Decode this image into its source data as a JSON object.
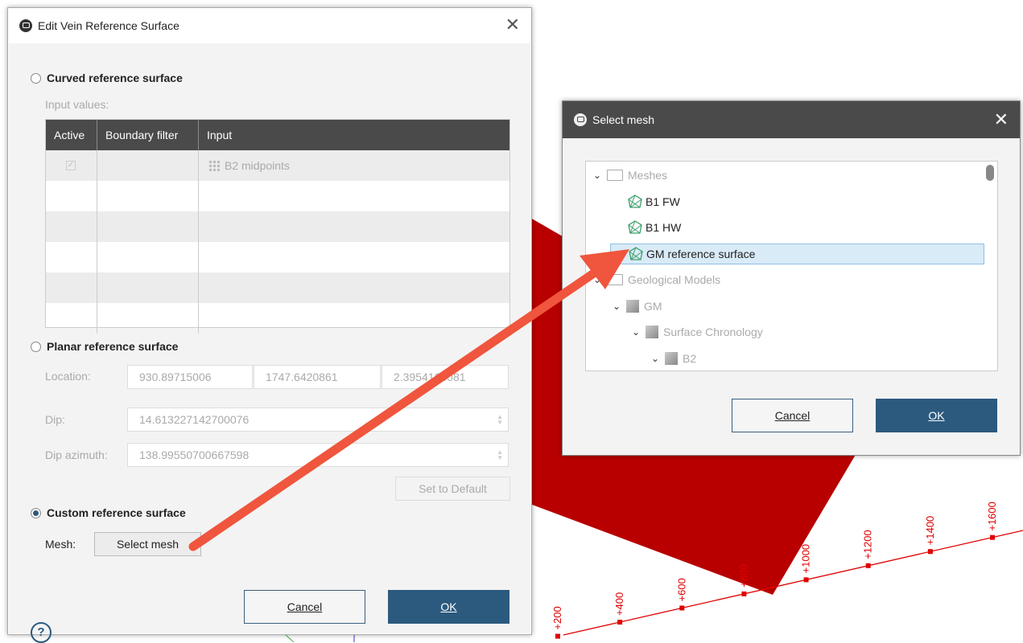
{
  "edit_dialog": {
    "title": "Edit Vein Reference Surface",
    "curved": {
      "label": "Curved reference surface",
      "input_values_label": "Input values:",
      "columns": [
        "Active",
        "Boundary filter",
        "Input"
      ],
      "rows": [
        {
          "active": true,
          "boundary_filter": "",
          "input": "B2 midpoints"
        }
      ]
    },
    "planar": {
      "label": "Planar reference surface",
      "location_label": "Location:",
      "location": [
        "930.89715006",
        "1747.6420861",
        "2.3954166081"
      ],
      "dip_label": "Dip:",
      "dip": "14.613227142700076",
      "dip_azimuth_label": "Dip azimuth:",
      "dip_azimuth": "138.99550700667598",
      "set_default": "Set to Default"
    },
    "custom": {
      "label": "Custom reference surface",
      "selected": true,
      "mesh_label": "Mesh:",
      "select_mesh": "Select mesh"
    },
    "cancel": "Cancel",
    "ok": "OK",
    "help": "?"
  },
  "select_dialog": {
    "title": "Select mesh",
    "tree": [
      {
        "label": "Meshes",
        "level": 0,
        "kind": "folder",
        "expanded": true,
        "disabled": true
      },
      {
        "label": "B1 FW",
        "level": 1,
        "kind": "mesh"
      },
      {
        "label": "B1 HW",
        "level": 1,
        "kind": "mesh"
      },
      {
        "label": "GM reference surface",
        "level": 1,
        "kind": "mesh",
        "selected": true
      },
      {
        "label": "Geological Models",
        "level": 0,
        "kind": "folder",
        "expanded": true,
        "disabled": true
      },
      {
        "label": "GM",
        "level": 1,
        "kind": "model",
        "expanded": true,
        "disabled": true
      },
      {
        "label": "Surface Chronology",
        "level": 2,
        "kind": "chronology",
        "expanded": true,
        "disabled": true
      },
      {
        "label": "B2",
        "level": 3,
        "kind": "surface",
        "expanded": true,
        "disabled": true
      }
    ],
    "cancel": "Cancel",
    "ok": "OK"
  },
  "scene": {
    "surface_color": "#b80000",
    "line_color": "#e00000",
    "tick_labels": [
      "+200",
      "+400",
      "+600",
      "+800",
      "+1000",
      "+1200",
      "+1400",
      "+1600"
    ]
  },
  "colors": {
    "accent": "#2b5a7e",
    "arrow": "#f0553d"
  }
}
